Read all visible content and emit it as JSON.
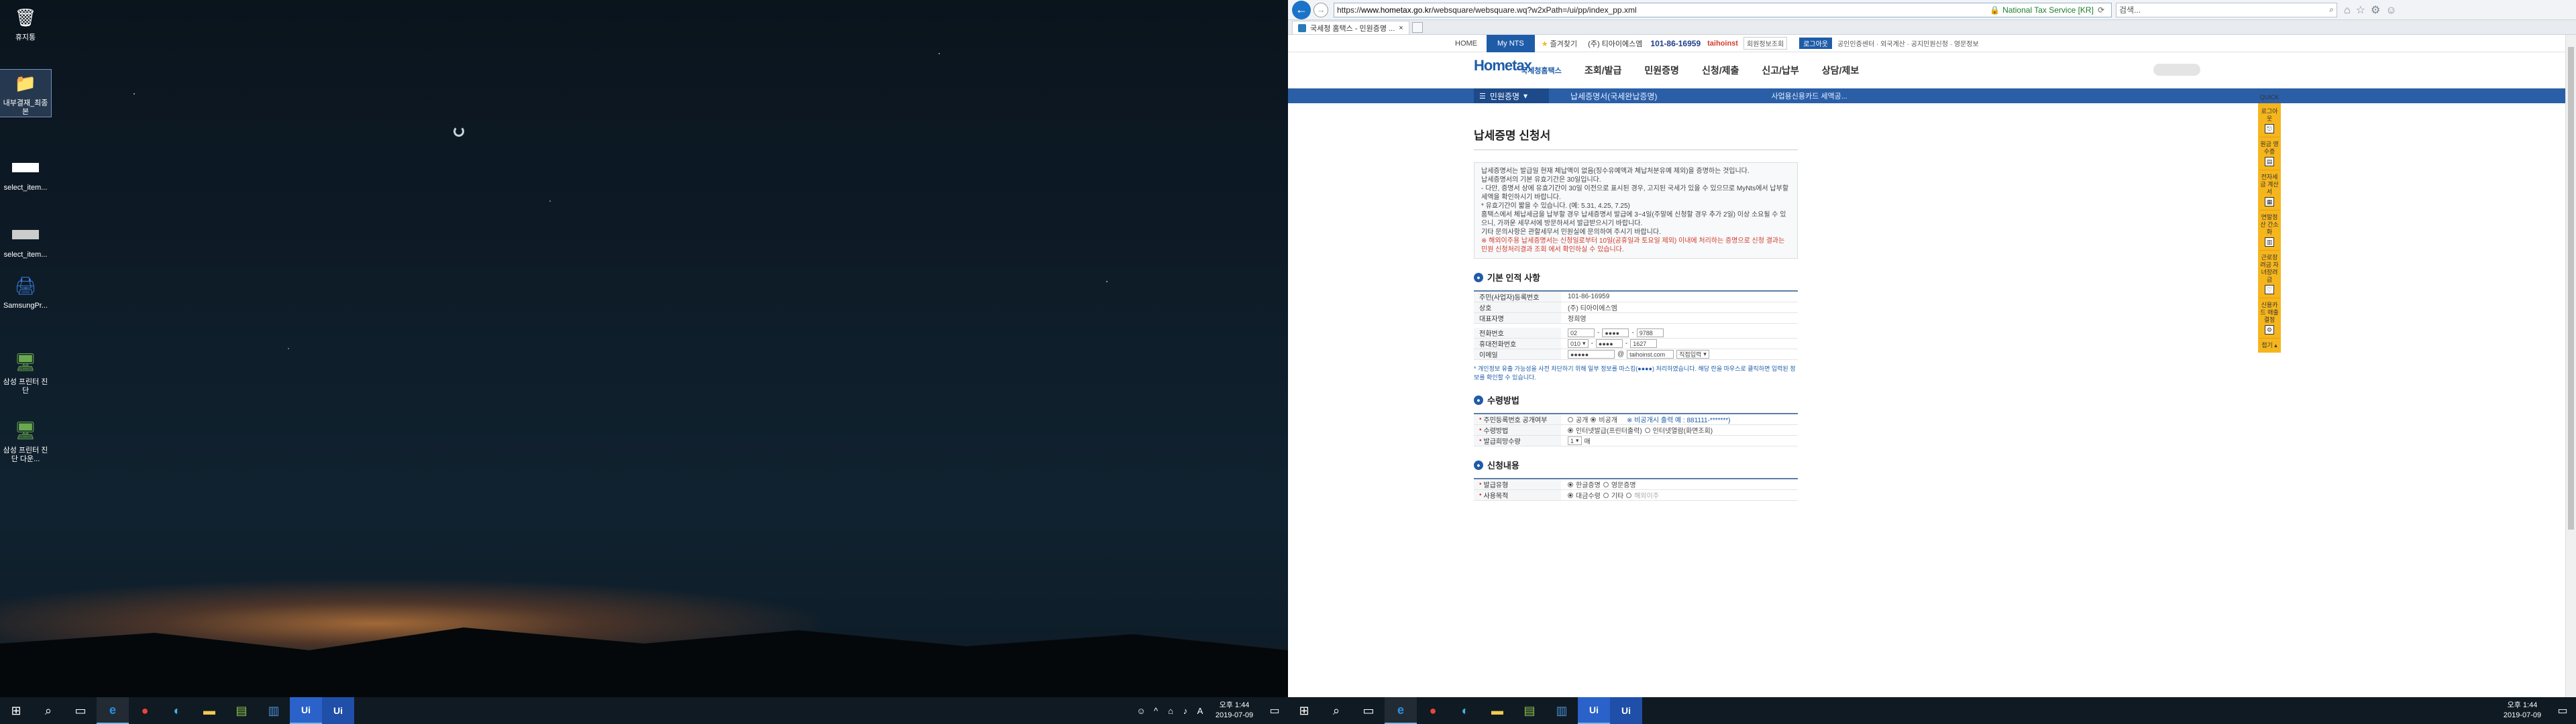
{
  "left": {
    "icons": [
      {
        "label": "휴지통",
        "icon": "trash-icon"
      },
      {
        "label": "내부결재_최종본",
        "icon": "folder-icon"
      },
      {
        "label": "select_item...",
        "icon": "image-icon"
      },
      {
        "label": "select_item...",
        "icon": "image-icon"
      },
      {
        "label": "SamsungPr...",
        "icon": "samsung-icon"
      },
      {
        "label": "삼성 프린터 진단",
        "icon": "printer-diag-icon"
      },
      {
        "label": "삼성 프린터 진단 다운...",
        "icon": "printer-diag-icon"
      }
    ],
    "taskbar": {
      "clock_time": "오후 1:44",
      "clock_date": "2019-07-09",
      "ime": "A"
    }
  },
  "right": {
    "browser": {
      "url_prefix": "https://",
      "url_domain": "www.hometax.go.kr",
      "url_rest": "/websquare/websquare.wq?w2xPath=/ui/pp/index_pp.xml",
      "cert": "National Tax Service [KR]",
      "search_placeholder": "검색...",
      "tab_title": "국세청 홈택스 - 민원증명 ..."
    },
    "util": {
      "home": "HOME",
      "mynts": "My NTS",
      "fav": "즐겨찾기",
      "user": "(주) 티아이에스엠",
      "bizno": "101-86-16959",
      "uname": "taihoinst",
      "uinfo": "회원정보조회",
      "logout": "로그아웃",
      "links": "공인인증센터 · 외국계산 · 공지민원신청 · 영문정보"
    },
    "gnb": {
      "logo_main": "Hometax",
      "logo_sub": "국세청홈택스",
      "menu": [
        "조회/발급",
        "민원증명",
        "신청/제출",
        "신고/납부",
        "상담/제보"
      ]
    },
    "lnb": {
      "current": "민원증명",
      "crumb": "납세증명서(국세완납증명)",
      "sub": "사업용신용카드 세액공..."
    },
    "content": {
      "title": "납세증명 신청서",
      "notice": [
        "납세증명서는 발급일 현재 체납액이 없음(징수유예액과 체납처분유예 제외)을 증명하는 것입니다.",
        "납세증명서의 기본 유효기간은 30일입니다.",
        " - 다만, 증명서 상에 유효기간이 30일 이전으로 표시된 경우, 고지된 국세가 있을 수 있으므로 MyNts에서 납부할 세액을 확인하시기 바랍니다.",
        " * 유효기간이 짧을 수 있습니다. (예: 5.31, 4.25, 7.25)",
        "홈택스에서 체납세금을 납부할 경우 납세증명서 발급에 3~4일(주말에 신청할 경우 추가 2일) 이상 소요될 수 있으니, 가까운 세무서에 방문하셔서 발급받으시기 바랍니다.",
        "기타 문의사항은 관할세무서 민원실에 문의하여 주시기 바랍니다.",
        "※ 해외이주용 납세증명서는 신청일로부터 10일(공휴일과 토요일 제외) 이내에 처리하는 증명으로 신청 결과는 민원 신청처리결과 조회 에서 확인하실 수 있습니다."
      ],
      "sec1": "기본 인적 사항",
      "rows1": [
        {
          "label": "주민(사업자)등록번호",
          "value": "101-86-16959"
        },
        {
          "label": "상호",
          "value": "(주) 티아이에스엠"
        },
        {
          "label": "대표자명",
          "value": "정희영"
        }
      ],
      "phone_label": "전화번호",
      "phone": [
        "02",
        "●●●●",
        "9788"
      ],
      "mobile_label": "휴대전화번호",
      "mobile": [
        "010",
        "●●●●",
        "1627"
      ],
      "email_label": "이메일",
      "email_id": "●●●●●",
      "email_domain": "taihoinst.com",
      "email_select": "직접입력",
      "privacy_note": "* 개인정보 유출 가능성을 사전 차단하기 위해 일부 정보를 마스킹(●●●●) 처리하였습니다. 해당 란을 마우스로 클릭하면 입력된 정보를 확인할 수 있습니다.",
      "sec2": "수령방법",
      "disclose_label": "주민등록번호 공개여부",
      "disclose_opts": [
        "공개",
        "비공개"
      ],
      "disclose_hint": "※ 비공개시 출력 예 : 881111-*******)",
      "receive_label": "수령방법",
      "receive_opts": [
        "인터넷발급(프린터출력)",
        "인터넷열람(화면조회)"
      ],
      "count_label": "발급희망수량",
      "count_value": "1",
      "count_unit": "매",
      "sec3": "신청내용",
      "type_label": "발급유형",
      "type_opts": [
        "한글증명",
        "영문증명"
      ],
      "purpose_label": "사용목적",
      "purpose_opts": [
        "대금수령",
        "기타",
        "해외이주"
      ]
    },
    "quick": {
      "title": "QUICK",
      "items": [
        "로그아웃",
        "원금 영수증",
        "전자세금 계산서",
        "연말정산 간소화",
        "근로장려금 자녀장려금",
        "신용카드 매출결정"
      ],
      "close": "접기"
    },
    "taskbar": {
      "clock_time": "오후 1:44",
      "clock_date": "2019-07-09"
    }
  }
}
